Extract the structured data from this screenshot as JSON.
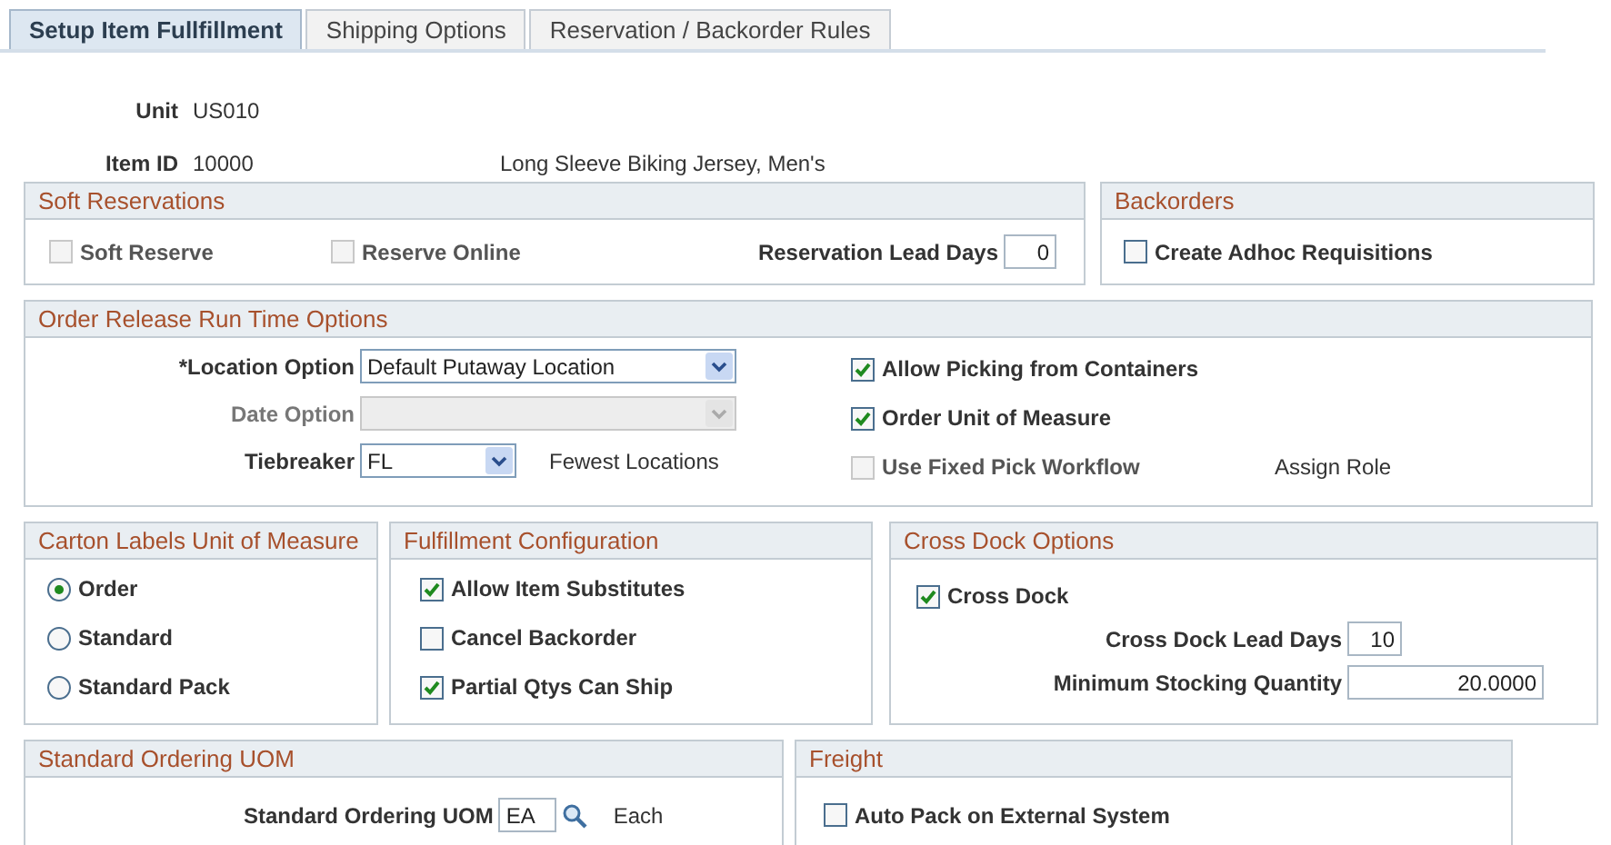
{
  "tabs": [
    {
      "label": "Setup Item Fullfillment",
      "selected": true
    },
    {
      "label": "Shipping Options",
      "selected": false
    },
    {
      "label": "Reservation / Backorder Rules",
      "selected": false
    }
  ],
  "header": {
    "unit": {
      "label": "Unit",
      "value": "US010"
    },
    "item": {
      "label": "Item ID",
      "value": "10000",
      "description": "Long Sleeve Biking Jersey, Men's"
    }
  },
  "soft_reservations": {
    "title": "Soft Reservations",
    "options": [
      {
        "label": "Soft Reserve",
        "checked": false,
        "disabled": true
      },
      {
        "label": "Reserve Online",
        "checked": false,
        "disabled": true
      }
    ],
    "lead_days": {
      "label": "Reservation Lead Days",
      "value": "0"
    }
  },
  "backorders": {
    "title": "Backorders",
    "options": [
      {
        "label": "Create Adhoc Requisitions",
        "checked": false,
        "disabled": false
      }
    ]
  },
  "order_release": {
    "title": "Order Release Run Time Options",
    "location_option": {
      "label": "*Location Option",
      "value": "Default Putaway Location",
      "disabled": false
    },
    "date_option": {
      "label": "Date Option",
      "disabled": true
    },
    "tiebreaker": {
      "label": "Tiebreaker",
      "value": "FL",
      "description": "Fewest Locations",
      "disabled": false
    },
    "options": [
      {
        "label": "Allow Picking from Containers",
        "checked": true,
        "disabled": false
      },
      {
        "label": "Order Unit of Measure",
        "checked": true,
        "disabled": false
      },
      {
        "label": "Use Fixed Pick Workflow",
        "checked": false,
        "disabled": true
      }
    ],
    "assign_role": "Assign Role"
  },
  "carton_labels": {
    "title": "Carton Labels Unit of Measure",
    "options": [
      {
        "label": "Order",
        "selected": true
      },
      {
        "label": "Standard",
        "selected": false
      },
      {
        "label": "Standard Pack",
        "selected": false
      }
    ]
  },
  "fulfillment": {
    "title": "Fulfillment Configuration",
    "options": [
      {
        "label": "Allow Item Substitutes",
        "checked": true,
        "disabled": false
      },
      {
        "label": "Cancel Backorder",
        "checked": false,
        "disabled": false
      },
      {
        "label": "Partial Qtys Can Ship",
        "checked": true,
        "disabled": false
      }
    ]
  },
  "cross_dock": {
    "title": "Cross Dock Options",
    "option": {
      "label": "Cross Dock",
      "checked": true,
      "disabled": false
    },
    "fields": [
      {
        "label": "Cross Dock Lead Days",
        "value": "10"
      },
      {
        "label": "Minimum Stocking Quantity",
        "value": "20.0000"
      }
    ]
  },
  "standard_ordering": {
    "title": "Standard Ordering UOM",
    "field": {
      "label": "Standard Ordering UOM",
      "value": "EA",
      "description": "Each"
    }
  },
  "freight": {
    "title": "Freight",
    "options": [
      {
        "label": "Auto Pack on External System",
        "checked": false,
        "disabled": false
      }
    ]
  }
}
